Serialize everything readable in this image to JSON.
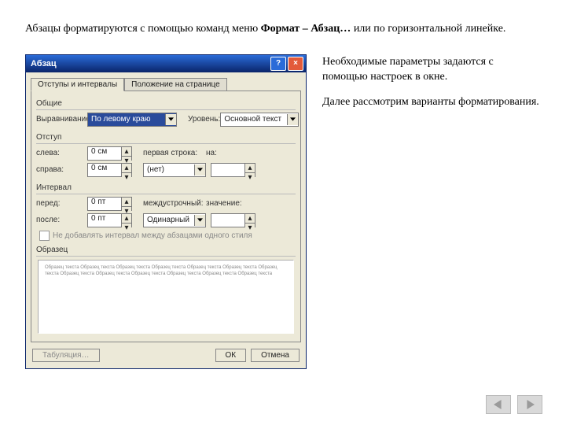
{
  "intro": {
    "pre": "Абзацы форматируются с помощью команд меню ",
    "bold1": "Формат – Абзац…",
    "post": " или по горизонтальной линейке."
  },
  "right": {
    "p1": "Необходимые параметры задаются с помощью настроек в окне.",
    "p2": "Далее рассмотрим варианты форматирования."
  },
  "dlg": {
    "title": "Абзац",
    "tabs": {
      "a": "Отступы и интервалы",
      "b": "Положение на странице"
    },
    "general_label": "Общие",
    "align_lbl": "Выравнивание:",
    "align_value": "По левому краю",
    "level_lbl": "Уровень:",
    "level_value": "Основной текст",
    "indent_label": "Отступ",
    "left_lbl": "слева:",
    "left_val": "0 см",
    "right_lbl": "справа:",
    "right_val": "0 см",
    "first_lbl": "первая строка:",
    "first_val": "(нет)",
    "by1_lbl": "на:",
    "interval_label": "Интервал",
    "before_lbl": "перед:",
    "before_val": "0 пт",
    "after_lbl": "после:",
    "after_val": "0 пт",
    "linesp_lbl": "междустрочный:",
    "linesp_val": "Одинарный",
    "by2_lbl": "значение:",
    "nosame_chk": "Не добавлять интервал между абзацами одного стиля",
    "preview_label": "Образец",
    "preview_text": "Образец текста Образец текста Образец текста Образец текста Образец текста Образец текста Образец текста Образец текста Образец текста Образец текста Образец текста Образец текста Образец текста",
    "tabs_btn": "Табуляция…",
    "ok": "ОК",
    "cancel": "Отмена"
  }
}
